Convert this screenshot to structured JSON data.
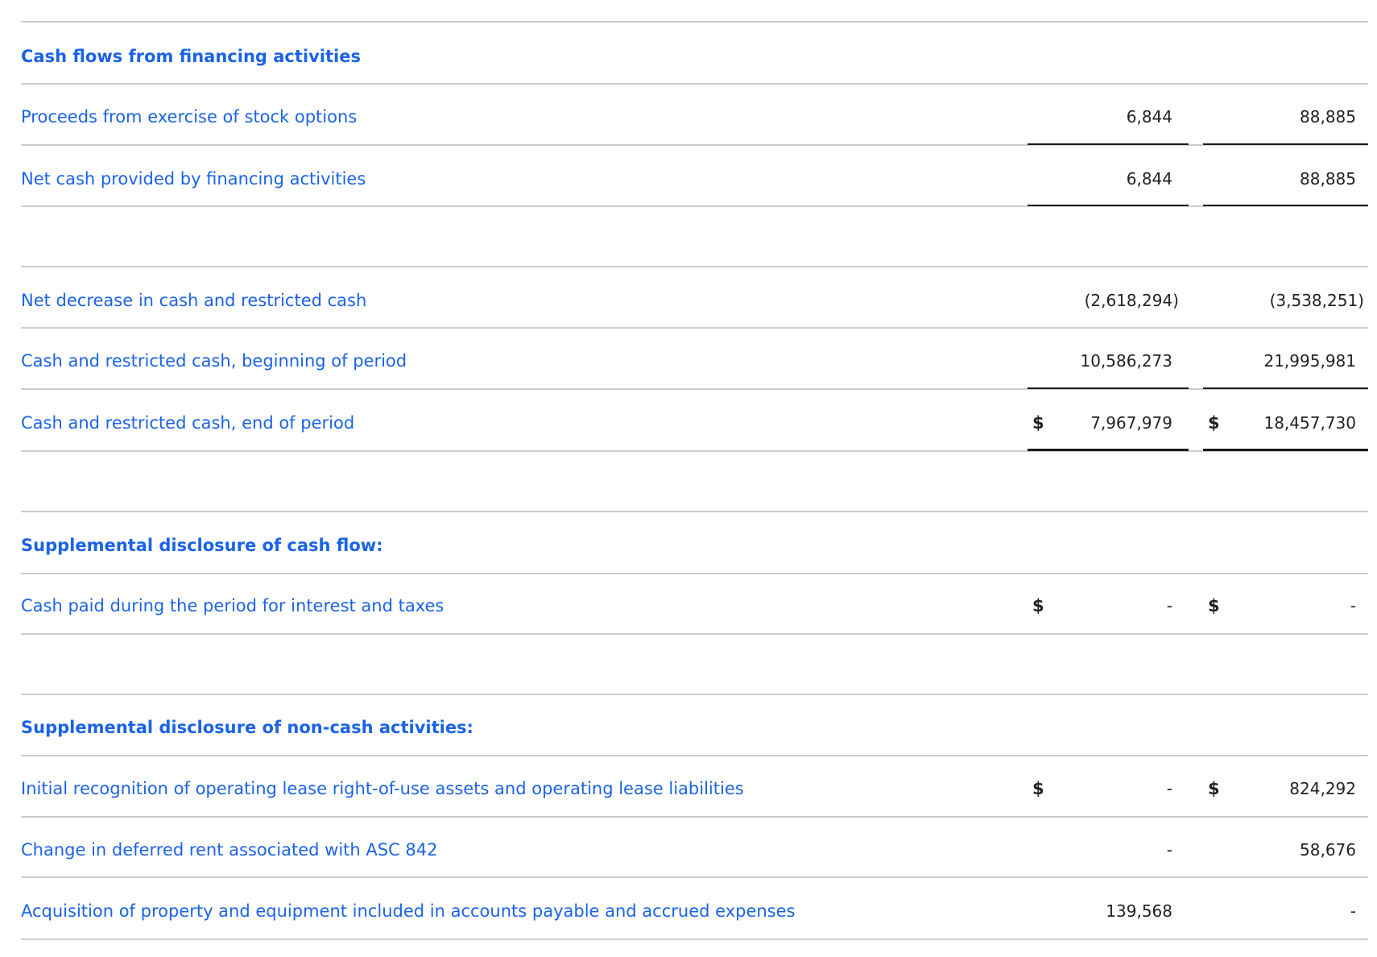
{
  "sections": {
    "financing_header": "Cash flows from financing activities",
    "supplemental_cash_flow_header": "Supplemental disclosure of cash flow:",
    "supplemental_non_cash_header": "Supplemental disclosure of non-cash activities:"
  },
  "currency_symbol": "$",
  "rows": {
    "proceeds_stock_options": {
      "label": "Proceeds from exercise of stock options",
      "col1": "6,844",
      "col2": "88,885"
    },
    "net_cash_financing": {
      "label": "Net cash provided by financing activities",
      "col1": "6,844",
      "col2": "88,885"
    },
    "net_decrease_cash": {
      "label": "Net decrease in cash and restricted cash",
      "col1": "(2,618,294)",
      "col2": "(3,538,251)"
    },
    "cash_beginning": {
      "label": "Cash and restricted cash, beginning of period",
      "col1": "10,586,273",
      "col2": "21,995,981"
    },
    "cash_end": {
      "label": "Cash and restricted cash, end of period",
      "col1": "7,967,979",
      "col2": "18,457,730"
    },
    "cash_paid_interest_taxes": {
      "label": "Cash paid during the period for interest and taxes",
      "col1": "-",
      "col2": "-"
    },
    "initial_recognition_lease": {
      "label": "Initial recognition of operating lease right-of-use assets and operating lease liabilities",
      "col1": "-",
      "col2": "824,292"
    },
    "change_deferred_rent": {
      "label": "Change in deferred rent associated with ASC 842",
      "col1": "-",
      "col2": "58,676"
    },
    "acquisition_property_equipment": {
      "label": "Acquisition of property and equipment included in accounts payable and accrued expenses",
      "col1": "139,568",
      "col2": "-"
    }
  },
  "colors": {
    "label_blue": "#1b63e6",
    "number_text": "#222222",
    "divider": "#cdcdcd",
    "underline": "#1a1a1a"
  }
}
